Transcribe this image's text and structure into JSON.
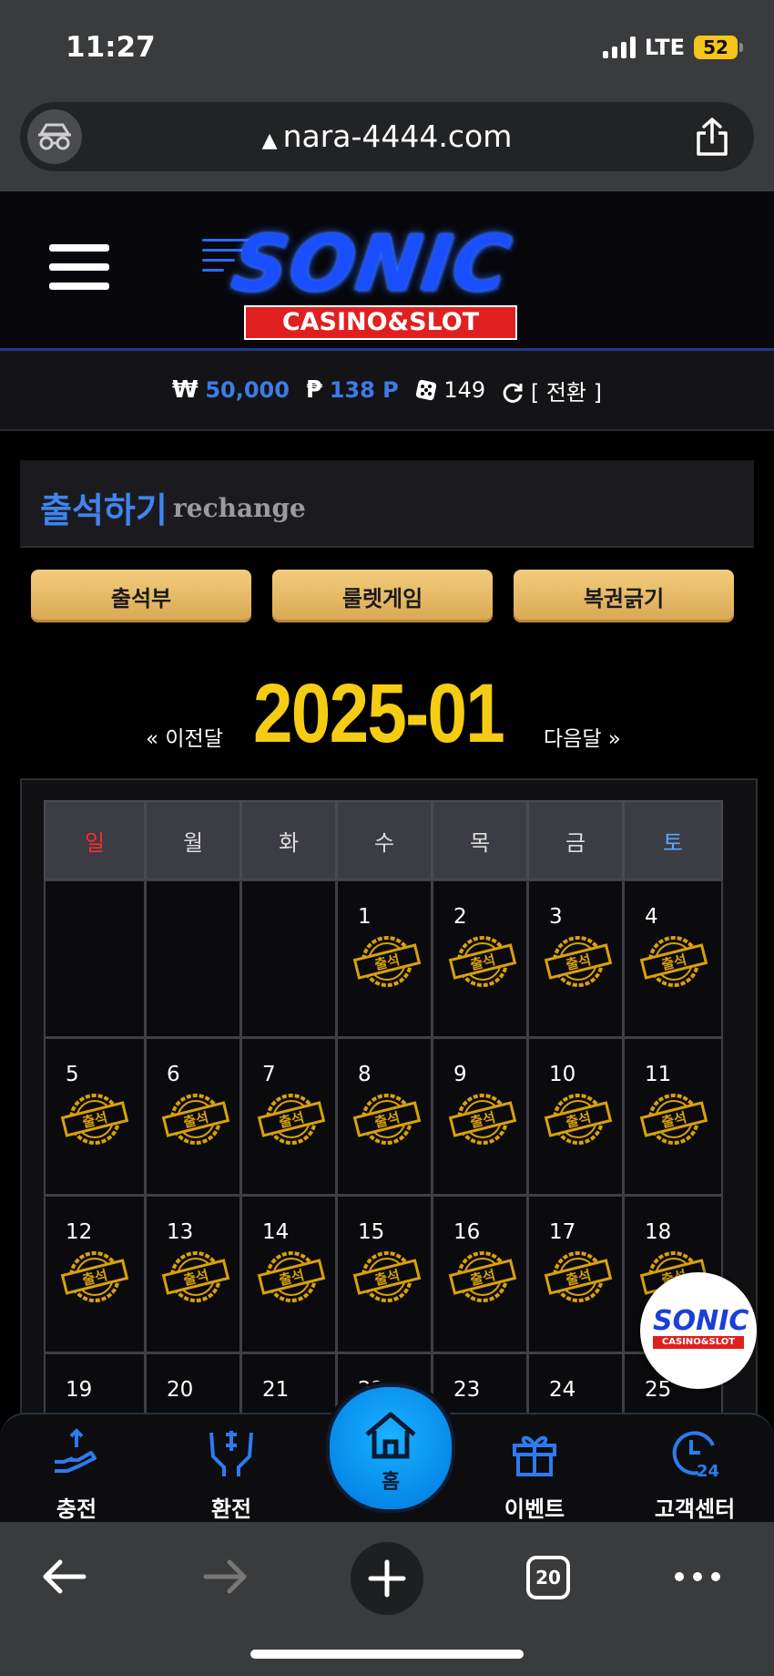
{
  "status": {
    "time": "11:27",
    "network": "LTE",
    "battery": "52"
  },
  "browser": {
    "url": "nara-4444.com",
    "tab_count": "20"
  },
  "header": {
    "logo_text": "SONIC",
    "logo_sub": "CASINO&SLOT"
  },
  "balance": {
    "won_symbol": "₩",
    "won": "50,000",
    "point_symbol": "₱",
    "points": "138 P",
    "chips": "149",
    "convert_label": "[ 전환 ]"
  },
  "attendance": {
    "title": "출석하기",
    "subtitle": "rechange"
  },
  "buttons": [
    "출석부",
    "룰렛게임",
    "복권긁기"
  ],
  "calendar": {
    "prev": "« 이전달",
    "next": "다음달 »",
    "month": "2025-01",
    "weekdays": [
      "일",
      "월",
      "화",
      "수",
      "목",
      "금",
      "토"
    ],
    "stamp_text": "출석",
    "weeks": [
      [
        "",
        "",
        "",
        "1",
        "2",
        "3",
        "4"
      ],
      [
        "5",
        "6",
        "7",
        "8",
        "9",
        "10",
        "11"
      ],
      [
        "12",
        "13",
        "14",
        "15",
        "16",
        "17",
        "18"
      ],
      [
        "19",
        "20",
        "21",
        "22",
        "23",
        "24",
        "25"
      ]
    ]
  },
  "bottom_nav": {
    "charge": "충전",
    "exchange": "환전",
    "home": "홈",
    "event": "이벤트",
    "support": "고객센터"
  },
  "colors": {
    "accent_blue": "#3f84f0",
    "gold": "#f5cc14",
    "stamp": "#d9a10a"
  }
}
